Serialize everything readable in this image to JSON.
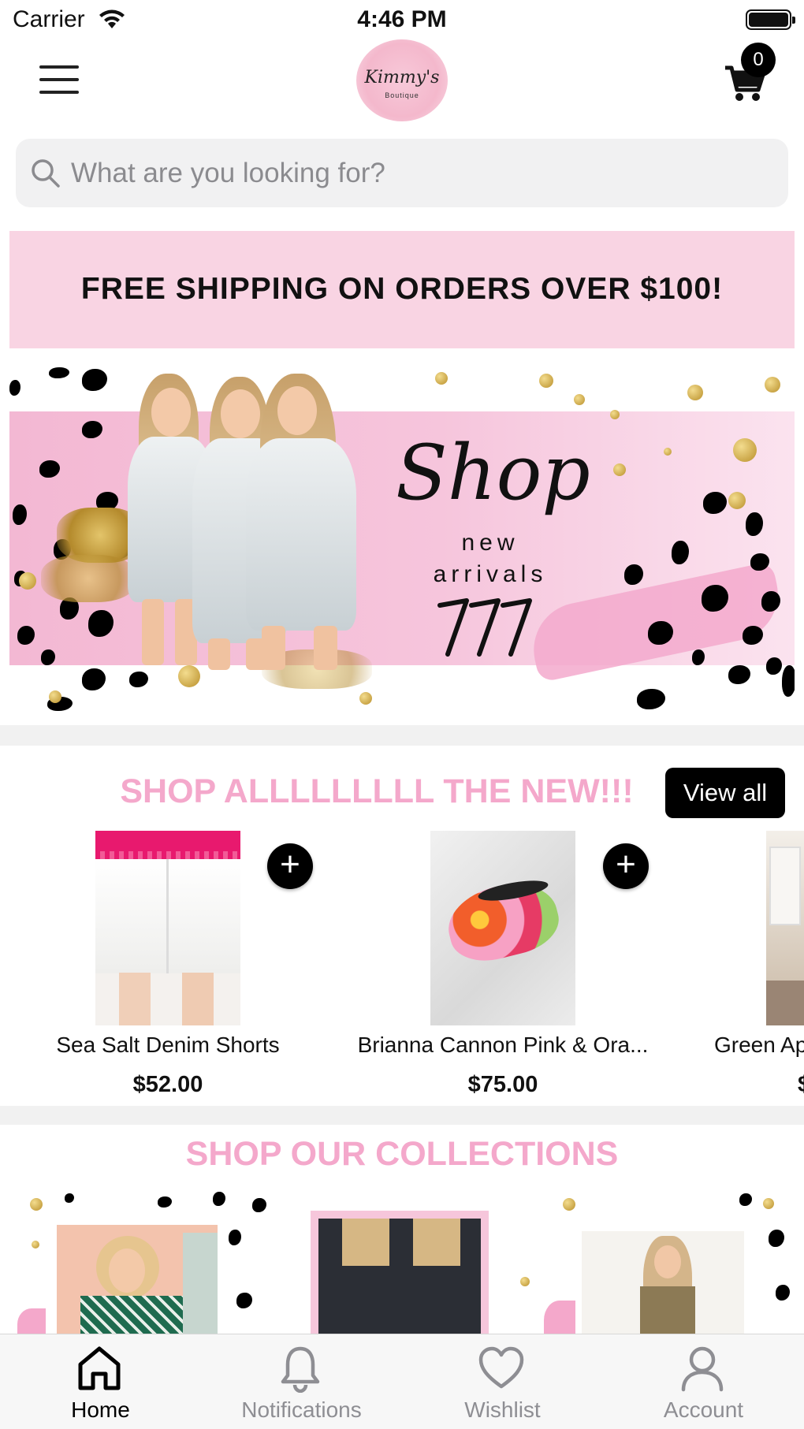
{
  "status_bar": {
    "carrier": "Carrier",
    "time": "4:46 PM"
  },
  "header": {
    "logo_text": "Kimmy's",
    "logo_subtext": "Boutique",
    "cart_count": "0"
  },
  "search": {
    "placeholder": "What are you looking for?"
  },
  "shipping_banner": {
    "text": "FREE SHIPPING ON ORDERS OVER $100!"
  },
  "hero": {
    "headline": "Shop",
    "line1": "new",
    "line2": "arrivals",
    "colors": {
      "pink": "#f4b9d4",
      "black_dots": "#000000",
      "gold": "#c9a23a"
    }
  },
  "new_section": {
    "title": "SHOP ALLLLLLLLL THE NEW!!!",
    "view_all_label": "View all",
    "add_label": "+",
    "products": [
      {
        "name": "Sea Salt Denim Shorts",
        "price": "$52.00"
      },
      {
        "name": "Brianna Cannon Pink & Ora...",
        "price": "$75.00"
      },
      {
        "name": "Green Ap",
        "price": "$"
      }
    ]
  },
  "collections_section": {
    "title": "SHOP OUR COLLECTIONS"
  },
  "tab_bar": {
    "tabs": [
      {
        "label": "Home",
        "icon": "home-icon",
        "active": true
      },
      {
        "label": "Notifications",
        "icon": "bell-icon",
        "active": false
      },
      {
        "label": "Wishlist",
        "icon": "heart-icon",
        "active": false
      },
      {
        "label": "Account",
        "icon": "person-icon",
        "active": false
      }
    ]
  },
  "colors": {
    "accent_pink": "#f4a8cb",
    "banner_pink": "#f9d4e3",
    "active_tab": "#000000",
    "inactive_tab": "#8e8e93"
  }
}
